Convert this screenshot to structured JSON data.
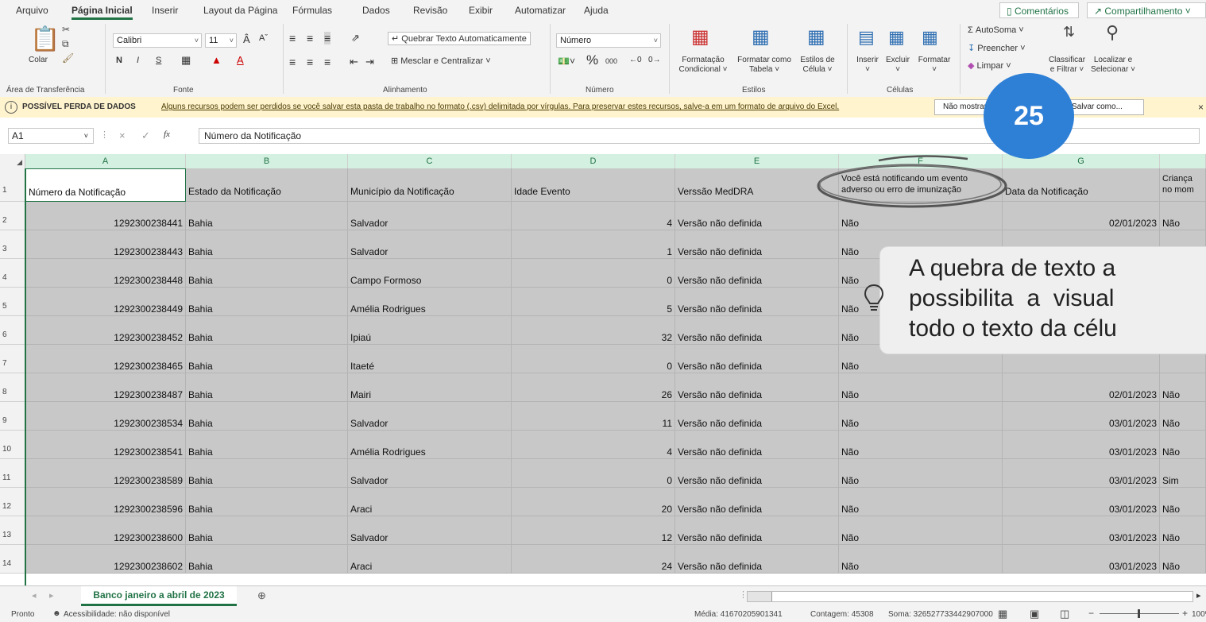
{
  "menu": {
    "items": [
      "Arquivo",
      "Página Inicial",
      "Inserir",
      "Layout da Página",
      "Fórmulas",
      "Dados",
      "Revisão",
      "Exibir",
      "Automatizar",
      "Ajuda"
    ],
    "comments": "Comentários",
    "share": "Compartilhamento"
  },
  "ribbon": {
    "clipboard": {
      "paste": "Colar",
      "label": "Área de Transferência"
    },
    "font": {
      "name": "Calibri",
      "size": "11",
      "bold": "N",
      "italic": "I",
      "underline": "S",
      "label": "Fonte"
    },
    "alignment": {
      "wrap": "Quebrar Texto Automaticamente",
      "merge": "Mesclar e Centralizar",
      "label": "Alinhamento"
    },
    "number": {
      "format": "Número",
      "percent": "%",
      "thousands": "000",
      "label": "Número"
    },
    "styles": {
      "conditional": [
        "Formatação",
        "Condicional"
      ],
      "table": [
        "Formatar como",
        "Tabela"
      ],
      "cell": [
        "Estilos de",
        "Célula"
      ],
      "label": "Estilos"
    },
    "cells": {
      "insert": "Inserir",
      "delete": "Excluir",
      "format": "Formatar",
      "label": "Células"
    },
    "editing": {
      "autosum": "AutoSoma",
      "fill": "Preencher",
      "clear": "Limpar",
      "sort": [
        "Classificar",
        "e Filtrar"
      ],
      "find": [
        "Localizar e",
        "Selecionar"
      ]
    }
  },
  "message": {
    "title": "POSSÍVEL PERDA DE DADOS",
    "text": "Alguns recursos podem ser perdidos se você salvar esta pasta de trabalho no formato (.csv) delimitada por vírgulas. Para preservar estes recursos, salve-a em um formato de arquivo do Excel.",
    "dont_show": "Não mostrar",
    "save_as": "Salvar como..."
  },
  "formula": {
    "cell_ref": "A1",
    "fx": "fx",
    "content": "Número da Notificação"
  },
  "columns": [
    "A",
    "B",
    "C",
    "D",
    "E",
    "F",
    "G"
  ],
  "headers": [
    "Número da Notificação",
    "Estado da Notificação",
    "Município da Notificação",
    "Idade Evento",
    "Verssão MedDRA",
    "Você está notificando um evento adverso ou erro de imunização",
    "Data da Notificação",
    "Criança no mom"
  ],
  "rows": [
    {
      "n": "2",
      "a": "1292300238441",
      "b": "Bahia",
      "c": "Salvador",
      "d": "4",
      "e": "Versão não definida",
      "f": "Não",
      "g": "02/01/2023",
      "h": "Não"
    },
    {
      "n": "3",
      "a": "1292300238443",
      "b": "Bahia",
      "c": "Salvador",
      "d": "1",
      "e": "Versão não definida",
      "f": "Não",
      "g": "",
      "h": ""
    },
    {
      "n": "4",
      "a": "1292300238448",
      "b": "Bahia",
      "c": "Campo Formoso",
      "d": "0",
      "e": "Versão não definida",
      "f": "Não",
      "g": "",
      "h": ""
    },
    {
      "n": "5",
      "a": "1292300238449",
      "b": "Bahia",
      "c": "Amélia Rodrigues",
      "d": "5",
      "e": "Versão não definida",
      "f": "Não",
      "g": "",
      "h": ""
    },
    {
      "n": "6",
      "a": "1292300238452",
      "b": "Bahia",
      "c": "Ipiaú",
      "d": "32",
      "e": "Versão não definida",
      "f": "Não",
      "g": "",
      "h": ""
    },
    {
      "n": "7",
      "a": "1292300238465",
      "b": "Bahia",
      "c": "Itaeté",
      "d": "0",
      "e": "Versão não definida",
      "f": "Não",
      "g": "",
      "h": ""
    },
    {
      "n": "8",
      "a": "1292300238487",
      "b": "Bahia",
      "c": "Mairi",
      "d": "26",
      "e": "Versão não definida",
      "f": "Não",
      "g": "02/01/2023",
      "h": "Não"
    },
    {
      "n": "9",
      "a": "1292300238534",
      "b": "Bahia",
      "c": "Salvador",
      "d": "11",
      "e": "Versão não definida",
      "f": "Não",
      "g": "03/01/2023",
      "h": "Não"
    },
    {
      "n": "10",
      "a": "1292300238541",
      "b": "Bahia",
      "c": "Amélia Rodrigues",
      "d": "4",
      "e": "Versão não definida",
      "f": "Não",
      "g": "03/01/2023",
      "h": "Não"
    },
    {
      "n": "11",
      "a": "1292300238589",
      "b": "Bahia",
      "c": "Salvador",
      "d": "0",
      "e": "Versão não definida",
      "f": "Não",
      "g": "03/01/2023",
      "h": "Sim"
    },
    {
      "n": "12",
      "a": "1292300238596",
      "b": "Bahia",
      "c": "Araci",
      "d": "20",
      "e": "Versão não definida",
      "f": "Não",
      "g": "03/01/2023",
      "h": "Não"
    },
    {
      "n": "13",
      "a": "1292300238600",
      "b": "Bahia",
      "c": "Salvador",
      "d": "12",
      "e": "Versão não definida",
      "f": "Não",
      "g": "03/01/2023",
      "h": "Não"
    },
    {
      "n": "14",
      "a": "1292300238602",
      "b": "Bahia",
      "c": "Araci",
      "d": "24",
      "e": "Versão não definida",
      "f": "Não",
      "g": "03/01/2023",
      "h": "Não"
    }
  ],
  "sheet_tab": "Banco janeiro a abril de 2023",
  "status": {
    "ready": "Pronto",
    "accessibility": "Acessibilidade: não disponível",
    "average": "Média: 41670205901341",
    "count": "Contagem: 45308",
    "sum": "Soma: 326527733442907000",
    "zoom": "100%"
  },
  "overlay": {
    "badge": "25",
    "tip_lines": [
      "A quebra de texto a",
      "possibilita  a  visual",
      "todo o texto da célu"
    ],
    "icon": "lightbulb-icon",
    "accent": "#2e7fd6"
  }
}
